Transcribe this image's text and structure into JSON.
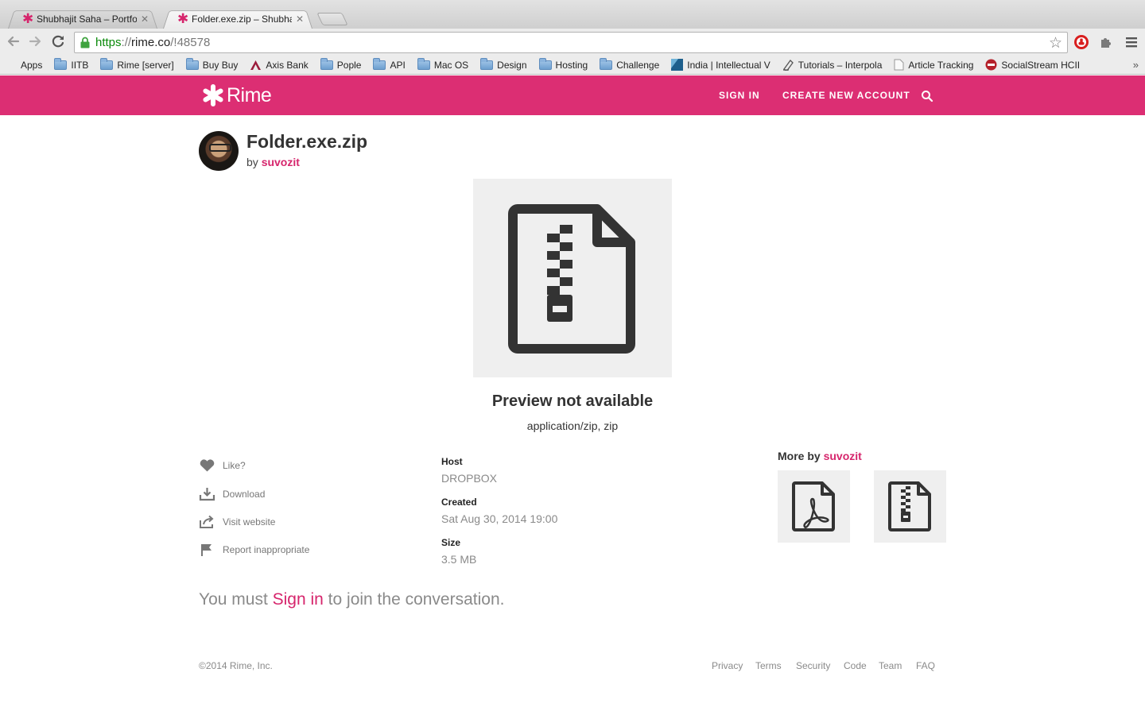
{
  "browser": {
    "tabs": [
      {
        "title": "Shubhajit Saha – Portfolio",
        "active": false
      },
      {
        "title": "Folder.exe.zip – Shubhajit",
        "active": true
      }
    ],
    "url": {
      "scheme": "https",
      "sep": "://",
      "host": "rime.co",
      "path": "/!48578"
    },
    "bookmarks": [
      {
        "label": "Apps",
        "icon": "apps-grid-icon"
      },
      {
        "label": "IITB",
        "icon": "folder-icon"
      },
      {
        "label": "Rime [server]",
        "icon": "folder-icon"
      },
      {
        "label": "Buy Buy",
        "icon": "folder-icon"
      },
      {
        "label": "Axis Bank",
        "icon": "axis-bank-icon"
      },
      {
        "label": "Pople",
        "icon": "folder-icon"
      },
      {
        "label": "API",
        "icon": "folder-icon"
      },
      {
        "label": "Mac OS",
        "icon": "folder-icon"
      },
      {
        "label": "Design",
        "icon": "folder-icon"
      },
      {
        "label": "Hosting",
        "icon": "folder-icon"
      },
      {
        "label": "Challenge",
        "icon": "folder-icon"
      },
      {
        "label": "India | Intellectual V",
        "icon": "page-favicon-icon"
      },
      {
        "label": "Tutorials – Interpola",
        "icon": "page-favicon-icon"
      },
      {
        "label": "Article Tracking",
        "icon": "page-icon"
      },
      {
        "label": "SocialStream HCII",
        "icon": "hcii-icon"
      }
    ],
    "more_glyph": "»"
  },
  "header": {
    "brand": "Rime",
    "sign_in": "SIGN IN",
    "create_account": "CREATE NEW ACCOUNT",
    "accent": "#dc2e73"
  },
  "file": {
    "title": "Folder.exe.zip",
    "by": "by",
    "author": "suvozit",
    "preview_message": "Preview not available",
    "mime": "application/zip, zip"
  },
  "actions": {
    "like": "Like?",
    "download": "Download",
    "visit": "Visit website",
    "report": "Report inappropriate"
  },
  "meta": {
    "host_label": "Host",
    "host_value": "DROPBOX",
    "created_label": "Created",
    "created_value": "Sat Aug 30, 2014 19:00",
    "size_label": "Size",
    "size_value": "3.5 MB"
  },
  "more": {
    "prefix": "More by",
    "author": "suvozit",
    "items": [
      {
        "icon": "pdf-file-icon"
      },
      {
        "icon": "zip-file-icon"
      }
    ]
  },
  "conversation": {
    "before": "You must ",
    "link": "Sign in",
    "after": " to join the conversation."
  },
  "footer": {
    "copyright": "©2014 Rime, Inc.",
    "links": [
      "Privacy",
      "Terms",
      "Security",
      "Code",
      "Team",
      "FAQ"
    ]
  }
}
